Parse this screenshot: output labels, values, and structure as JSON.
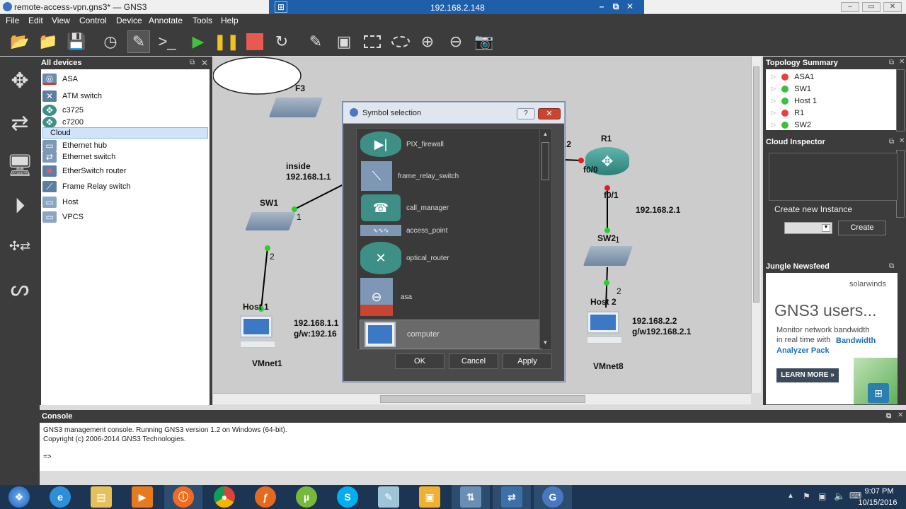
{
  "window": {
    "title": "remote-access-vpn.gns3* — GNS3"
  },
  "remote_bar": {
    "ip": "192.168.2.148",
    "pin": "⊞",
    "min": "–",
    "restore": "⧉",
    "close": "✕"
  },
  "window_controls": {
    "min": "–",
    "restore": "▭",
    "close": "✕"
  },
  "menu": [
    "File",
    "Edit",
    "View",
    "Control",
    "Device",
    "Annotate",
    "Tools",
    "Help"
  ],
  "devices_panel": {
    "title": "All devices",
    "items": [
      {
        "label": "ASA",
        "icon": "firewall-icon"
      },
      {
        "label": "ATM switch",
        "icon": "atm-switch-icon"
      },
      {
        "label": "c3725",
        "icon": "router-icon"
      },
      {
        "label": "c7200",
        "icon": "router-icon"
      },
      {
        "label": "Cloud",
        "icon": "cloud-icon"
      },
      {
        "label": "Ethernet hub",
        "icon": "hub-icon"
      },
      {
        "label": "Ethernet switch",
        "icon": "switch-icon"
      },
      {
        "label": "EtherSwitch router",
        "icon": "etherswitch-icon"
      },
      {
        "label": "Frame Relay switch",
        "icon": "frame-relay-icon"
      },
      {
        "label": "Host",
        "icon": "host-icon"
      },
      {
        "label": "VPCS",
        "icon": "vpcs-icon"
      }
    ]
  },
  "topology": {
    "f3_label": "F3",
    "inside_label": "inside",
    "inside_ip": "192.168.1.1",
    "sw1": {
      "name": "SW1",
      "port1": "1",
      "port2": "2"
    },
    "host1": {
      "name": "Host 1",
      "ip": "192.168.1.1",
      "gw": "g/w:192.16",
      "net": "VMnet1"
    },
    "r1": {
      "name": "R1",
      "left_ip_fragment": ".2",
      "f00": "f0/0",
      "f01": "f0/1",
      "ip": "192.168.2.1"
    },
    "sw2": {
      "name": "SW2",
      "port1": "1",
      "port2": "2"
    },
    "host2": {
      "name": "Host 2",
      "ip": "192.168.2.2",
      "gw": "g/w192.168.2.1",
      "net": "VMnet8"
    }
  },
  "dialog": {
    "title": "Symbol selection",
    "help": "?",
    "close": "✕",
    "symbols": [
      {
        "label": "PIX_firewall"
      },
      {
        "label": "frame_relay_switch"
      },
      {
        "label": "call_manager"
      },
      {
        "label": "access_point"
      },
      {
        "label": "optical_router"
      },
      {
        "label": "asa"
      },
      {
        "label": "computer"
      }
    ],
    "ok": "OK",
    "cancel": "Cancel",
    "apply": "Apply"
  },
  "topology_summary": {
    "title": "Topology Summary",
    "items": [
      {
        "label": "ASA1",
        "status": "#e8403a"
      },
      {
        "label": "SW1",
        "status": "#3fbf3f"
      },
      {
        "label": "Host 1",
        "status": "#3fbf3f"
      },
      {
        "label": "R1",
        "status": "#e8403a"
      },
      {
        "label": "SW2",
        "status": "#3fbf3f"
      }
    ]
  },
  "cloud_inspector": {
    "title": "Cloud Inspector",
    "create_label": "Create new Instance",
    "create_button": "Create"
  },
  "newsfeed": {
    "title": "Jungle Newsfeed",
    "brand": "solarwinds",
    "headline": "GNS3 users...",
    "body1": "Monitor network bandwidth",
    "body2": "in real time with",
    "highlight": "Bandwidth Analyzer Pack",
    "cta": "LEARN MORE »"
  },
  "console": {
    "title": "Console",
    "line1": "GNS3 management console. Running GNS3 version 1.2 on Windows (64-bit).",
    "line2": "Copyright (c) 2006-2014 GNS3 Technologies.",
    "prompt": "=>"
  },
  "taskbar": {
    "time": "9:07 PM",
    "date": "10/15/2016"
  }
}
